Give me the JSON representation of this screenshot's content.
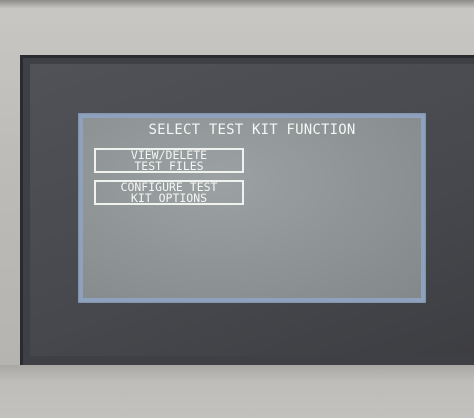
{
  "screen": {
    "title": "SELECT TEST KIT FUNCTION",
    "buttons": [
      {
        "line1": "VIEW/DELETE",
        "line2": "TEST FILES"
      },
      {
        "line1": "CONFIGURE TEST",
        "line2": "KIT OPTIONS"
      }
    ]
  },
  "colors": {
    "lcd_background": "#8e9395",
    "lcd_text": "#f4f6f3",
    "lcd_frame": "#8fa2bd",
    "bezel": "#bdbbb7",
    "frame_inner": "#3f4045"
  }
}
